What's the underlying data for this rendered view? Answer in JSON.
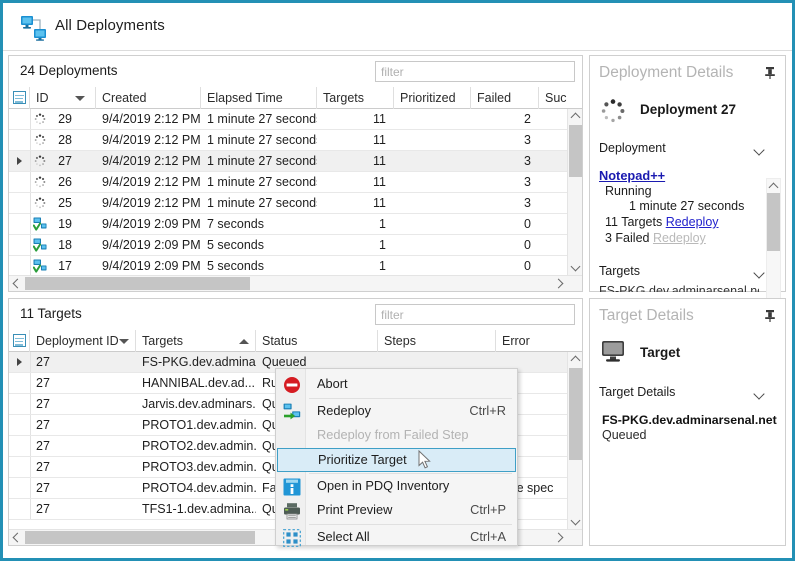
{
  "window": {
    "border_color": "#2390b5",
    "title": "All Deployments",
    "title_icon": "deployments-network-icon"
  },
  "deployments": {
    "panel_name": "deployments-panel",
    "count_label": "24 Deployments",
    "filter_placeholder": "filter",
    "filter_value": "",
    "columns": [
      {
        "key": "id",
        "label": "ID",
        "sort": "desc"
      },
      {
        "key": "created",
        "label": "Created",
        "sort": ""
      },
      {
        "key": "elapsed",
        "label": "Elapsed Time",
        "sort": ""
      },
      {
        "key": "targets",
        "label": "Targets",
        "sort": ""
      },
      {
        "key": "prioritized",
        "label": "Prioritized",
        "sort": ""
      },
      {
        "key": "failed",
        "label": "Failed",
        "sort": ""
      },
      {
        "key": "success",
        "label": "Suc",
        "sort": ""
      }
    ],
    "rows": [
      {
        "status_icon": "spinner-icon",
        "id": "29",
        "created": "9/4/2019 2:12 PM",
        "elapsed": "1 minute 27 seconds",
        "targets": "11",
        "prioritized": "",
        "failed": "2",
        "selected": false
      },
      {
        "status_icon": "spinner-icon",
        "id": "28",
        "created": "9/4/2019 2:12 PM",
        "elapsed": "1 minute 27 seconds",
        "targets": "11",
        "prioritized": "",
        "failed": "3",
        "selected": false
      },
      {
        "status_icon": "spinner-icon",
        "id": "27",
        "created": "9/4/2019 2:12 PM",
        "elapsed": "1 minute 27 seconds",
        "targets": "11",
        "prioritized": "",
        "failed": "3",
        "selected": true
      },
      {
        "status_icon": "spinner-icon",
        "id": "26",
        "created": "9/4/2019 2:12 PM",
        "elapsed": "1 minute 27 seconds",
        "targets": "11",
        "prioritized": "",
        "failed": "3",
        "selected": false
      },
      {
        "status_icon": "spinner-icon",
        "id": "25",
        "created": "9/4/2019 2:12 PM",
        "elapsed": "1 minute 27 seconds",
        "targets": "11",
        "prioritized": "",
        "failed": "3",
        "selected": false
      },
      {
        "status_icon": "deploy-success-icon",
        "id": "19",
        "created": "9/4/2019 2:09 PM",
        "elapsed": "7 seconds",
        "targets": "1",
        "prioritized": "",
        "failed": "0",
        "selected": false
      },
      {
        "status_icon": "deploy-success-icon",
        "id": "18",
        "created": "9/4/2019 2:09 PM",
        "elapsed": "5 seconds",
        "targets": "1",
        "prioritized": "",
        "failed": "0",
        "selected": false
      },
      {
        "status_icon": "deploy-success-icon",
        "id": "17",
        "created": "9/4/2019 2:09 PM",
        "elapsed": "5 seconds",
        "targets": "1",
        "prioritized": "",
        "failed": "0",
        "selected": false
      }
    ]
  },
  "targets": {
    "panel_name": "targets-panel",
    "count_label": "11 Targets",
    "filter_placeholder": "filter",
    "filter_value": "",
    "columns": [
      {
        "key": "deployment_id",
        "label": "Deployment ID",
        "sort": "desc"
      },
      {
        "key": "target",
        "label": "Targets",
        "sort": "asc"
      },
      {
        "key": "status",
        "label": "Status",
        "sort": ""
      },
      {
        "key": "steps",
        "label": "Steps",
        "sort": ""
      },
      {
        "key": "error",
        "label": "Error",
        "sort": ""
      }
    ],
    "rows": [
      {
        "deployment_id": "27",
        "target": "FS-PKG.dev.admina...",
        "status": "Queued",
        "steps": "",
        "error": "",
        "selected": true
      },
      {
        "deployment_id": "27",
        "target": "HANNIBAL.dev.ad...",
        "status": "Running",
        "steps": "",
        "error": "",
        "selected": false
      },
      {
        "deployment_id": "27",
        "target": "Jarvis.dev.adminars...",
        "status": "Queued",
        "steps": "",
        "error": "",
        "selected": false
      },
      {
        "deployment_id": "27",
        "target": "PROTO1.dev.admin...",
        "status": "Queued",
        "steps": "",
        "error": "",
        "selected": false
      },
      {
        "deployment_id": "27",
        "target": "PROTO2.dev.admin...",
        "status": "Queued",
        "steps": "",
        "error": "",
        "selected": false
      },
      {
        "deployment_id": "27",
        "target": "PROTO3.dev.admin...",
        "status": "Queued",
        "steps": "",
        "error": "",
        "selected": false
      },
      {
        "deployment_id": "27",
        "target": "PROTO4.dev.admin...",
        "status": "Failed",
        "steps": "",
        "error": "The spec",
        "selected": false
      },
      {
        "deployment_id": "27",
        "target": "TFS1-1.dev.admina...",
        "status": "Queued",
        "steps": "",
        "error": "",
        "selected": false
      }
    ]
  },
  "deployment_details": {
    "title": "Deployment Details",
    "pin_icon": "pin-icon",
    "hero_icon": "spinner-icon",
    "hero_label": "Deployment 27",
    "section_label": "Deployment",
    "package_link": "Notepad++",
    "state": "Running",
    "elapsed": "1 minute 27 seconds",
    "targets_count": "11 Targets",
    "targets_redeploy_link": "Redeploy",
    "failed_count": "3 Failed",
    "failed_redeploy_link": "Redeploy",
    "targets_section_label": "Targets",
    "targets_first_item": "FS-PKG.dev.adminarsenal.net"
  },
  "target_details": {
    "title": "Target Details",
    "pin_icon": "pin-icon",
    "hero_icon": "monitor-icon",
    "hero_label": "Target",
    "section_label": "Target Details",
    "target_name": "FS-PKG.dev.adminarsenal.net",
    "status": "Queued"
  },
  "context_menu": {
    "items": [
      {
        "label": "Abort",
        "shortcut": "",
        "icon": "abort-icon",
        "disabled": false,
        "highlighted": false,
        "separator_after": true
      },
      {
        "label": "Redeploy",
        "shortcut": "Ctrl+R",
        "icon": "redeploy-icon",
        "disabled": false,
        "highlighted": false,
        "separator_after": false
      },
      {
        "label": "Redeploy from Failed Step",
        "shortcut": "",
        "icon": "",
        "disabled": true,
        "highlighted": false,
        "separator_after": false
      },
      {
        "label": "Prioritize Target",
        "shortcut": "",
        "icon": "",
        "disabled": false,
        "highlighted": true,
        "separator_after": true
      },
      {
        "label": "Open in PDQ Inventory",
        "shortcut": "",
        "icon": "inventory-icon",
        "disabled": false,
        "highlighted": false,
        "separator_after": false
      },
      {
        "label": "Print Preview",
        "shortcut": "Ctrl+P",
        "icon": "printer-icon",
        "disabled": false,
        "highlighted": false,
        "separator_after": true
      },
      {
        "label": "Select All",
        "shortcut": "Ctrl+A",
        "icon": "select-all-icon",
        "disabled": false,
        "highlighted": false,
        "separator_after": false
      }
    ]
  }
}
